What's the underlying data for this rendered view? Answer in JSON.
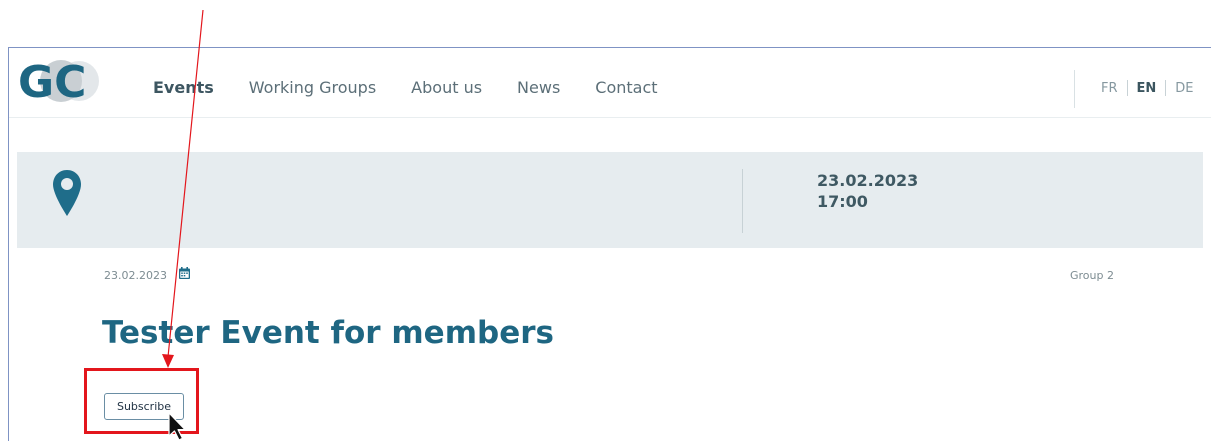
{
  "nav": {
    "logo_text": "GC",
    "links": [
      {
        "label": "Events",
        "active": true
      },
      {
        "label": "Working Groups",
        "active": false
      },
      {
        "label": "About us",
        "active": false
      },
      {
        "label": "News",
        "active": false
      },
      {
        "label": "Contact",
        "active": false
      }
    ],
    "languages": [
      {
        "code": "FR",
        "active": false
      },
      {
        "code": "EN",
        "active": true
      },
      {
        "code": "DE",
        "active": false
      }
    ]
  },
  "banner": {
    "icon": "location-pin-icon",
    "date": "23.02.2023",
    "time": "17:00",
    "accent_color": "#1f6d8a"
  },
  "event": {
    "date": "23.02.2023",
    "date_icon": "calendar-icon",
    "group": "Group 2",
    "title": "Tester Event for members",
    "subscribe_label": "Subscribe"
  },
  "annotation": {
    "color": "#e3161c",
    "cursor_icon": "mouse-pointer-icon"
  }
}
